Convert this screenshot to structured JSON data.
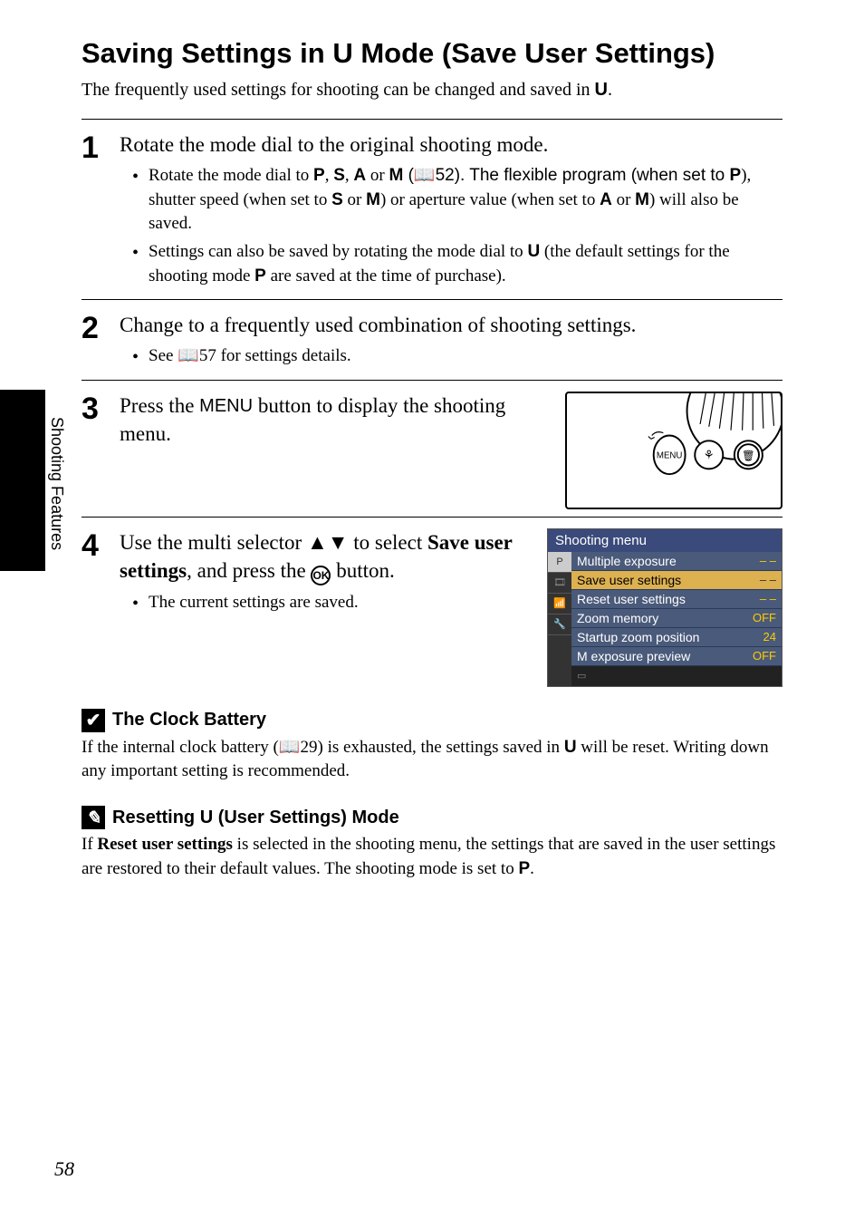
{
  "side_label": "Shooting Features",
  "page_number": "58",
  "title": {
    "part1": "Saving Settings in ",
    "u": "U",
    "part2": " Mode (Save User Settings)"
  },
  "intro": {
    "part1": "The frequently used settings for shooting can be changed and saved in ",
    "u": "U",
    "part2": "."
  },
  "steps": {
    "s1": {
      "num": "1",
      "head": "Rotate the mode dial to the original shooting mode.",
      "b1": {
        "t1": "Rotate the mode dial to ",
        "p": "P",
        "c1": ", ",
        "s": "S",
        "c2": ", ",
        "a": "A",
        "c3": " or ",
        "m": "M",
        "ref": " (📖52). The flexible program (when set to ",
        "p2": "P",
        "t3": "), shutter speed (when set to ",
        "s2": "S",
        "t4": " or ",
        "m2": "M",
        "t5": ") or aperture value (when set to ",
        "a2": "A",
        "t6": " or ",
        "m3": "M",
        "t7": ") will also be saved."
      },
      "b2": {
        "t1": "Settings can also be saved by rotating the mode dial to ",
        "u": "U",
        "t2": " (the default settings for the shooting mode ",
        "p": "P",
        "t3": " are saved at the time of purchase)."
      }
    },
    "s2": {
      "num": "2",
      "head": "Change to a frequently used combination of shooting settings.",
      "b1": "See 📖57 for settings details."
    },
    "s3": {
      "num": "3",
      "head": {
        "t1": "Press the ",
        "menu": "MENU",
        "t2": " button to display the shooting menu."
      }
    },
    "s4": {
      "num": "4",
      "head": {
        "t1": "Use the multi selector ",
        "tri": "▲▼",
        "t2": " to select ",
        "bold": "Save user settings",
        "t3": ", and press the ",
        "ok": "OK",
        "t4": " button."
      },
      "b1": "The current settings are saved."
    }
  },
  "shooting_menu": {
    "title": "Shooting menu",
    "items": [
      {
        "label": "Multiple exposure",
        "val": "– –"
      },
      {
        "label": "Save user settings",
        "val": "– –"
      },
      {
        "label": "Reset user settings",
        "val": "– –"
      },
      {
        "label": "Zoom memory",
        "val": "OFF"
      },
      {
        "label": "Startup zoom position",
        "val": "24"
      },
      {
        "label": "M exposure preview",
        "val": "OFF"
      }
    ]
  },
  "notes": {
    "clock": {
      "icon": "✔",
      "title": "The Clock Battery",
      "body": {
        "t1": "If the internal clock battery (📖29) is exhausted, the settings saved in ",
        "u": "U",
        "t2": " will be reset. Writing down any important setting is recommended."
      }
    },
    "reset": {
      "icon": "✎",
      "title": {
        "t1": "Resetting ",
        "u": "U",
        "t2": " (User Settings) Mode"
      },
      "body": {
        "t1": "If ",
        "bold": "Reset user settings",
        "t2": " is selected in the shooting menu, the settings that are saved in the user settings are restored to their default values. The shooting mode is set to ",
        "p": "P",
        "t3": "."
      }
    }
  }
}
